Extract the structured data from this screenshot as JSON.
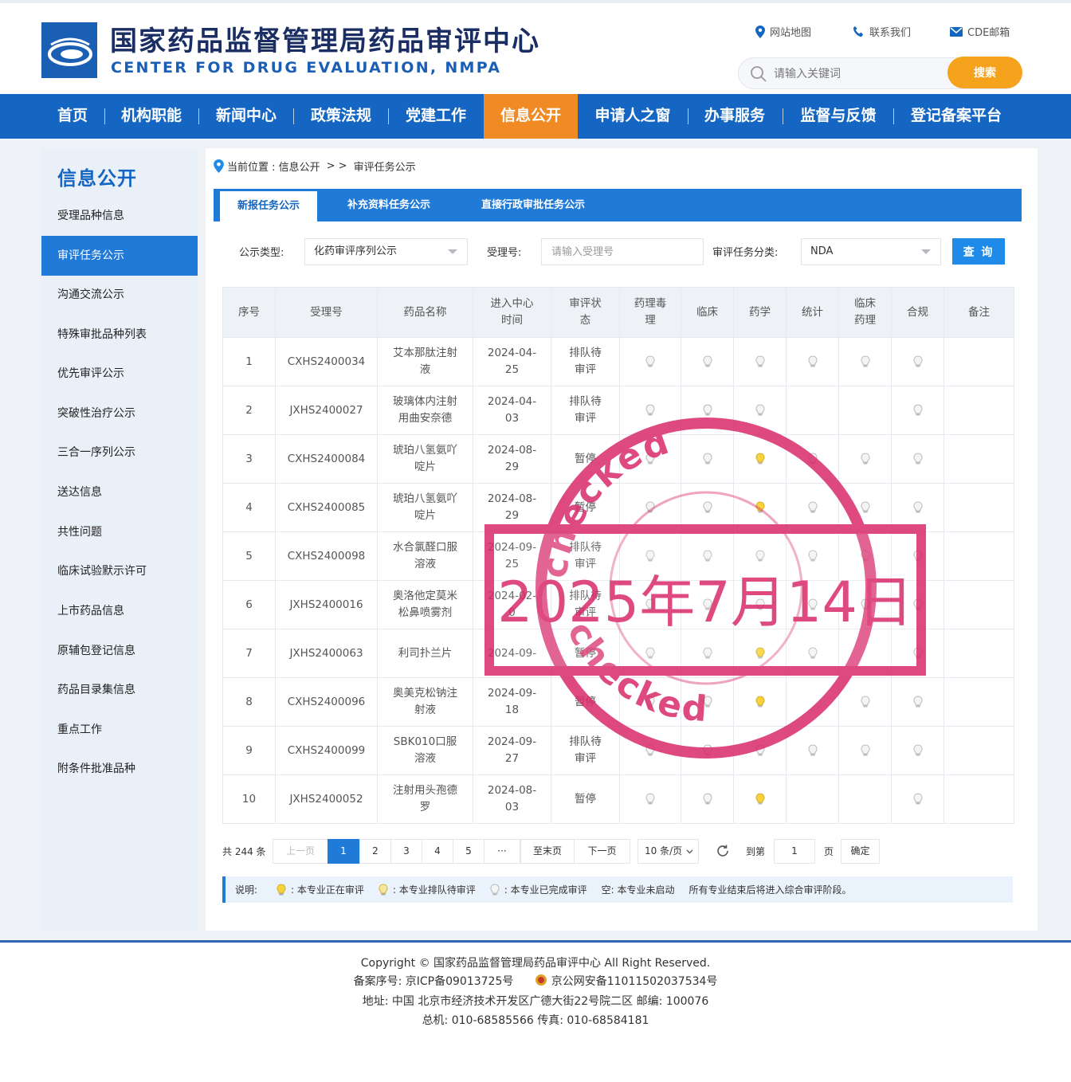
{
  "header": {
    "title_cn": "国家药品监督管理局药品审评中心",
    "title_en": "CENTER FOR DRUG EVALUATION, NMPA",
    "links": [
      "网站地图",
      "联系我们",
      "CDE邮箱"
    ],
    "search": {
      "placeholder": "请输入关键词",
      "button": "搜索"
    }
  },
  "nav": [
    "首页",
    "机构职能",
    "新闻中心",
    "政策法规",
    "党建工作",
    "信息公开",
    "申请人之窗",
    "办事服务",
    "监督与反馈",
    "登记备案平台"
  ],
  "sidebar": {
    "title": "信息公开",
    "items": [
      "受理品种信息",
      "审评任务公示",
      "沟通交流公示",
      "特殊审批品种列表",
      "优先审评公示",
      "突破性治疗公示",
      "三合一序列公示",
      "送达信息",
      "共性问题",
      "临床试验默示许可",
      "上市药品信息",
      "原辅包登记信息",
      "药品目录集信息",
      "重点工作",
      "附条件批准品种"
    ]
  },
  "breadcrumb": {
    "label": "当前位置 : 信息公开",
    "sep": "> >",
    "current": "审评任务公示"
  },
  "tabs": [
    "新报任务公示",
    "补充资料任务公示",
    "直接行政审批任务公示"
  ],
  "filters": {
    "type_label": "公示类型:",
    "type_value": "化药审评序列公示",
    "acceptance_label": "受理号:",
    "acceptance_placeholder": "请输入受理号",
    "category_label": "审评任务分类:",
    "category_value": "NDA",
    "query_button": "查 询"
  },
  "table": {
    "headers": [
      "序号",
      "受理号",
      "药品名称",
      "进入中心时间",
      "审评状态",
      "药理毒理",
      "临床",
      "药学",
      "统计",
      "临床药理",
      "合规",
      "备注"
    ],
    "rows": [
      {
        "no": "1",
        "id": "CXHS2400034",
        "name": "艾本那肽注射液",
        "date": "2024-04-25",
        "status": "排队待审评",
        "bulbs": [
          "done",
          "done",
          "done",
          "done",
          "done",
          "done"
        ]
      },
      {
        "no": "2",
        "id": "JXHS2400027",
        "name": "玻璃体内注射用曲安奈德",
        "date": "2024-04-03",
        "status": "排队待审评",
        "bulbs": [
          "done",
          "done",
          "done",
          "",
          "",
          "done"
        ]
      },
      {
        "no": "3",
        "id": "CXHS2400084",
        "name": "琥珀八氢氨吖啶片",
        "date": "2024-08-29",
        "status": "暂停",
        "bulbs": [
          "done",
          "done",
          "active",
          "done",
          "done",
          "done"
        ]
      },
      {
        "no": "4",
        "id": "CXHS2400085",
        "name": "琥珀八氢氨吖啶片",
        "date": "2024-08-29",
        "status": "暂停",
        "bulbs": [
          "done",
          "done",
          "active",
          "done",
          "done",
          "done"
        ]
      },
      {
        "no": "5",
        "id": "CXHS2400098",
        "name": "水合氯醛口服溶液",
        "date": "2024-09-25",
        "status": "排队待审评",
        "bulbs": [
          "done",
          "done",
          "done",
          "done",
          "done",
          "done"
        ]
      },
      {
        "no": "6",
        "id": "JXHS2400016",
        "name": "奥洛他定莫米松鼻喷雾剂",
        "date": "2024-02-0",
        "status": "排队待审评",
        "bulbs": [
          "done",
          "done",
          "done",
          "done",
          "done",
          "done"
        ]
      },
      {
        "no": "7",
        "id": "JXHS2400063",
        "name": "利司扑兰片",
        "date": "2024-09-",
        "status": "暂停",
        "bulbs": [
          "done",
          "done",
          "active",
          "done",
          "",
          "done"
        ]
      },
      {
        "no": "8",
        "id": "CXHS2400096",
        "name": "奥美克松钠注射液",
        "date": "2024-09-18",
        "status": "暂停",
        "bulbs": [
          "done",
          "done",
          "active",
          "",
          "done",
          "done"
        ]
      },
      {
        "no": "9",
        "id": "CXHS2400099",
        "name": "SBK010口服溶液",
        "date": "2024-09-27",
        "status": "排队待审评",
        "bulbs": [
          "done",
          "done",
          "done",
          "done",
          "done",
          "done"
        ]
      },
      {
        "no": "10",
        "id": "JXHS2400052",
        "name": "注射用头孢德罗",
        "date": "2024-08-03",
        "status": "暂停",
        "bulbs": [
          "done",
          "done",
          "active",
          "",
          "",
          "done"
        ]
      }
    ]
  },
  "pagination": {
    "total": "共 244 条",
    "prev": "上一页",
    "pages": [
      "1",
      "2",
      "3",
      "4",
      "5",
      "···"
    ],
    "last": "至末页",
    "next": "下一页",
    "page_size": "10 条/页",
    "goto_label": "到第",
    "goto_value": "1",
    "page_unit": "页",
    "confirm": "确定"
  },
  "legend": {
    "label": "说明:",
    "active": "本专业正在审评",
    "queued": "本专业排队待审评",
    "done": "本专业已完成审评",
    "empty": "空: 本专业未启动",
    "note": "所有专业结束后将进入综合审评阶段。"
  },
  "footer": {
    "copyright": "Copyright © 国家药品监督管理局药品审评中心    All Right Reserved.",
    "icp": "备案序号:  京ICP备09013725号",
    "police": "京公网安备11011502037534号",
    "address": "地址:  中国 北京市经济技术开发区广德大街22号院二区       邮编:  100076",
    "phone": "总机:  010-68585566      传真:  010-68584181"
  },
  "stamp": {
    "text_top": "checked",
    "date": "2025年7月14日",
    "color": "#d92b6b"
  },
  "colors": {
    "nav_blue": "#1466c2",
    "active_orange": "#f08a24",
    "search_orange": "#f5a21c",
    "stamp": "#d92b6b"
  }
}
